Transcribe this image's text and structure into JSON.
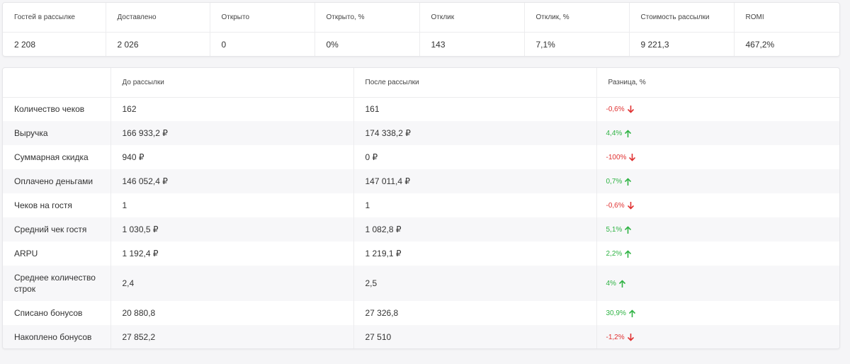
{
  "summary": {
    "headers": [
      "Гостей в рассылке",
      "Доставлено",
      "Открыто",
      "Открыто, %",
      "Отклик",
      "Отклик, %",
      "Стоимость рассылки",
      "ROMI"
    ],
    "values": [
      "2 208",
      "2 026",
      "0",
      "0%",
      "143",
      "7,1%",
      "9 221,3",
      "467,2%"
    ]
  },
  "comparison": {
    "headers": [
      "",
      "До рассылки",
      "После рассылки",
      "Разница, %"
    ],
    "rows": [
      {
        "metric": "Количество чеков",
        "before": "162",
        "after": "161",
        "diff": "-0,6%",
        "trend": "down"
      },
      {
        "metric": "Выручка",
        "before": "166 933,2 ₽",
        "after": "174 338,2 ₽",
        "diff": "4,4%",
        "trend": "up"
      },
      {
        "metric": "Суммарная скидка",
        "before": "940 ₽",
        "after": "0 ₽",
        "diff": "-100%",
        "trend": "down"
      },
      {
        "metric": "Оплачено деньгами",
        "before": "146 052,4 ₽",
        "after": "147 011,4 ₽",
        "diff": "0,7%",
        "trend": "up"
      },
      {
        "metric": "Чеков на гостя",
        "before": "1",
        "after": "1",
        "diff": "-0,6%",
        "trend": "down"
      },
      {
        "metric": "Средний чек гостя",
        "before": "1 030,5 ₽",
        "after": "1 082,8 ₽",
        "diff": "5,1%",
        "trend": "up"
      },
      {
        "metric": "ARPU",
        "before": "1 192,4 ₽",
        "after": "1 219,1 ₽",
        "diff": "2,2%",
        "trend": "up"
      },
      {
        "metric": "Среднее количество строк",
        "before": "2,4",
        "after": "2,5",
        "diff": "4%",
        "trend": "up"
      },
      {
        "metric": "Списано бонусов",
        "before": "20 880,8",
        "after": "27 326,8",
        "diff": "30,9%",
        "trend": "up"
      },
      {
        "metric": "Накоплено бонусов",
        "before": "27 852,2",
        "after": "27 510",
        "diff": "-1,2%",
        "trend": "down"
      }
    ]
  },
  "colors": {
    "negative": "#e03131",
    "positive": "#2fb344"
  },
  "icons": {
    "up": "arrow-up-icon",
    "down": "arrow-down-icon"
  }
}
